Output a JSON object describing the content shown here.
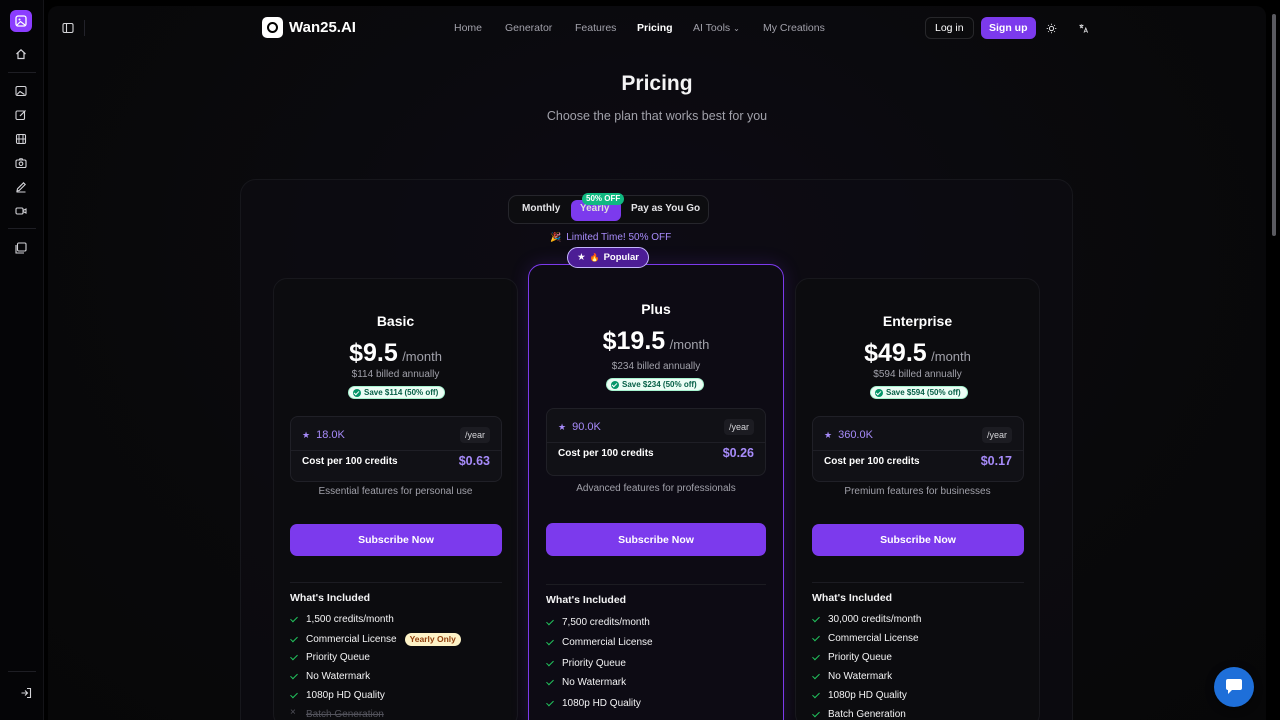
{
  "brand": {
    "name": "Wan25.AI"
  },
  "nav": [
    {
      "label": "Home"
    },
    {
      "label": "Generator"
    },
    {
      "label": "Features"
    },
    {
      "label": "Pricing"
    },
    {
      "label": "AI Tools"
    },
    {
      "label": "My Creations"
    }
  ],
  "header": {
    "login": "Log in",
    "signup": "Sign up"
  },
  "hero": {
    "title": "Pricing",
    "subtitle": "Choose the plan that works best for you"
  },
  "billing_toggle": {
    "monthly": "Monthly",
    "yearly": "Yearly",
    "payg": "Pay as You Go",
    "yearly_badge": "50% OFF",
    "selected": "Yearly"
  },
  "limited_offer": "Limited Time! 50% OFF",
  "popular_badge": "Popular",
  "colors": {
    "accent": "#7c3aed",
    "accent_light": "#a78bfa",
    "success": "#22c55e"
  },
  "plans": [
    {
      "name": "Basic",
      "price": "$9.5",
      "period": "/month",
      "billed": "$114 billed annually",
      "save": "Save $114 (50% off)",
      "credits": "18.0K",
      "credits_period": "/year",
      "cost_label": "Cost per 100 credits",
      "cost": "$0.63",
      "desc": "Essential features for personal use",
      "cta": "Subscribe Now",
      "included_title": "What's Included",
      "features": [
        {
          "label": "1,500 credits/month"
        },
        {
          "label": "Commercial License",
          "badge": "Yearly Only"
        },
        {
          "label": "Priority Queue"
        },
        {
          "label": "No Watermark"
        },
        {
          "label": "1080p HD Quality"
        },
        {
          "label": "Batch Generation",
          "disabled": true
        }
      ]
    },
    {
      "name": "Plus",
      "price": "$19.5",
      "period": "/month",
      "billed": "$234 billed annually",
      "save": "Save $234 (50% off)",
      "credits": "90.0K",
      "credits_period": "/year",
      "cost_label": "Cost per 100 credits",
      "cost": "$0.26",
      "desc": "Advanced features for professionals",
      "cta": "Subscribe Now",
      "included_title": "What's Included",
      "features": [
        {
          "label": "7,500 credits/month"
        },
        {
          "label": "Commercial License"
        },
        {
          "label": "Priority Queue"
        },
        {
          "label": "No Watermark"
        },
        {
          "label": "1080p HD Quality"
        }
      ]
    },
    {
      "name": "Enterprise",
      "price": "$49.5",
      "period": "/month",
      "billed": "$594 billed annually",
      "save": "Save $594 (50% off)",
      "credits": "360.0K",
      "credits_period": "/year",
      "cost_label": "Cost per 100 credits",
      "cost": "$0.17",
      "desc": "Premium features for businesses",
      "cta": "Subscribe Now",
      "included_title": "What's Included",
      "features": [
        {
          "label": "30,000 credits/month"
        },
        {
          "label": "Commercial License"
        },
        {
          "label": "Priority Queue"
        },
        {
          "label": "No Watermark"
        },
        {
          "label": "1080p HD Quality"
        },
        {
          "label": "Batch Generation"
        }
      ]
    }
  ]
}
